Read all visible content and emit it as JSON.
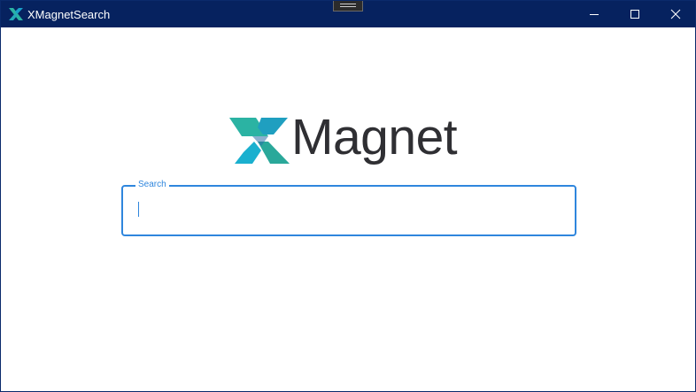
{
  "window": {
    "title": "XMagnetSearch",
    "titlebar_color": "#06225f",
    "icons": {
      "app": "xmagnet-logo-icon",
      "minimize": "minimize-icon",
      "maximize": "maximize-icon",
      "close": "close-icon"
    }
  },
  "logo": {
    "text": "Magnet",
    "mark_colors": [
      "#2bb3a3",
      "#1aa0c8",
      "#2c6fa8"
    ]
  },
  "search": {
    "label": "Search",
    "value": "",
    "accent": "#2f86dd"
  }
}
